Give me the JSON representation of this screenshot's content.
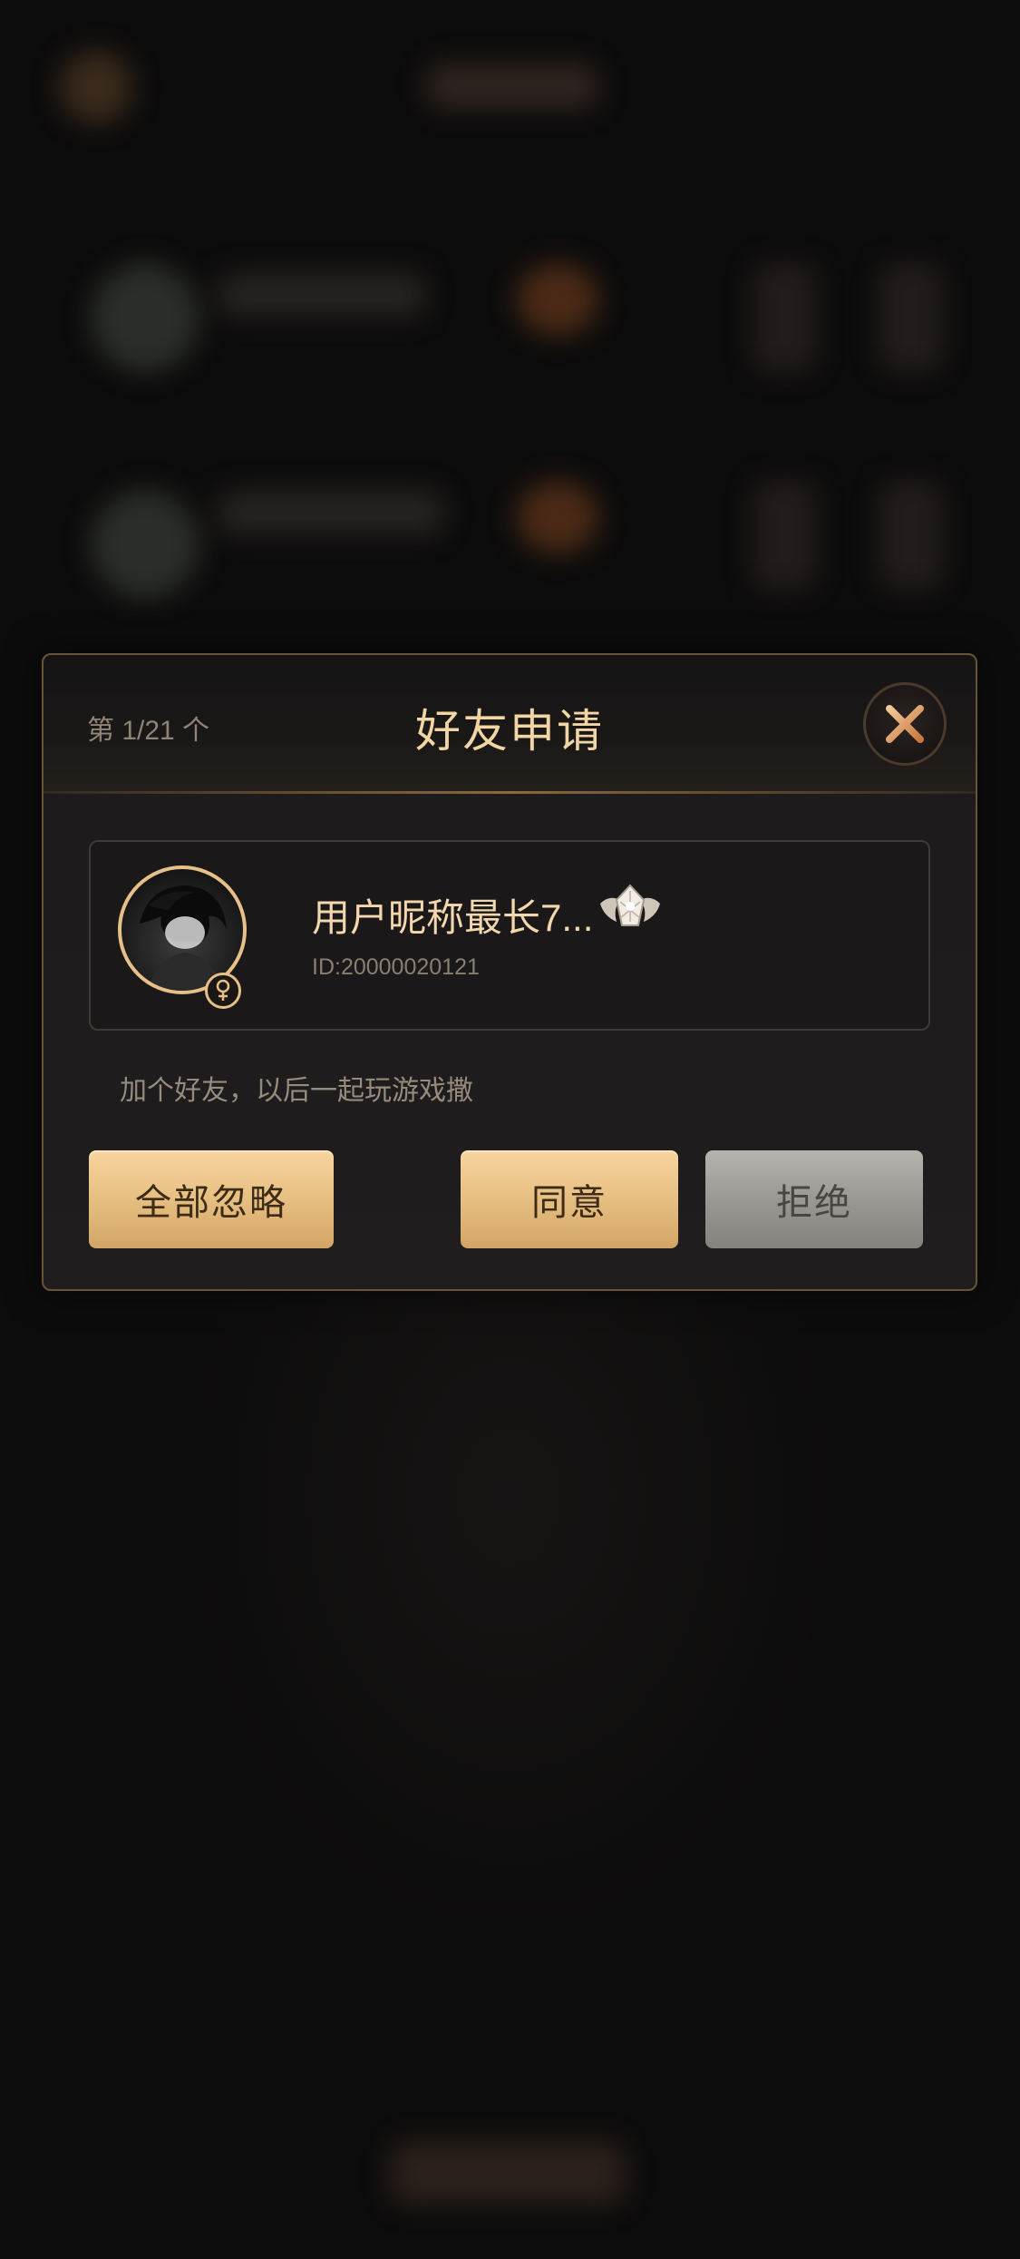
{
  "dialog": {
    "counter": "第 1/21 个",
    "title": "好友申请",
    "close_icon": "close-icon"
  },
  "user": {
    "nickname": "用户昵称最长7...",
    "id_text": "ID:20000020121",
    "gender_icon": "male-symbol-icon",
    "rank_icon": "winged-crystal-rank-icon"
  },
  "message": "加个好友，以后一起玩游戏撒",
  "buttons": {
    "ignore_all": "全部忽略",
    "agree": "同意",
    "reject": "拒绝"
  },
  "colors": {
    "accent_gold": "#e9c185",
    "title_text": "#f2d5a4",
    "dialog_border": "#6a5333",
    "reject_grey": "#9b9793"
  }
}
